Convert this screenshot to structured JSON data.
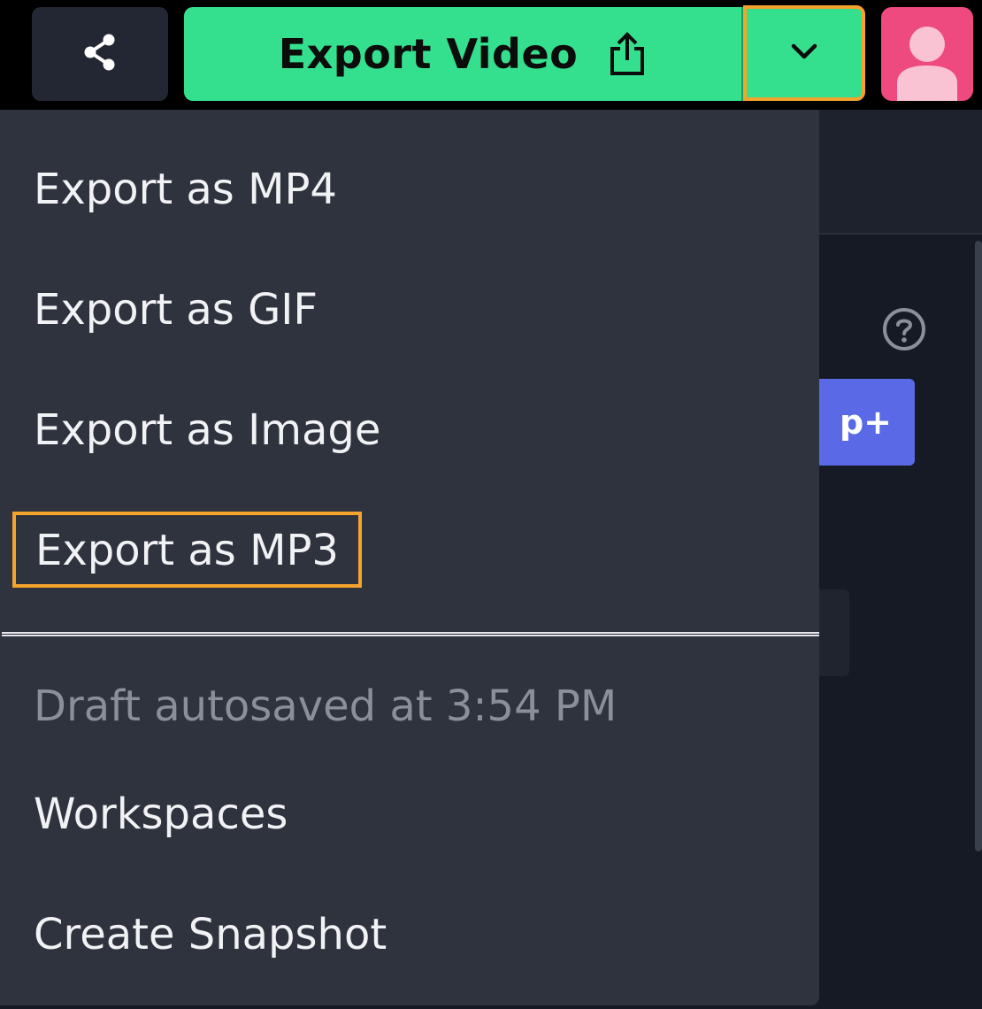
{
  "toolbar": {
    "export_label": "Export Video"
  },
  "background": {
    "upgrade_label": "p+"
  },
  "menu": {
    "items": [
      {
        "label": "Export as MP4"
      },
      {
        "label": "Export as GIF"
      },
      {
        "label": "Export as Image"
      },
      {
        "label": "Export as MP3"
      }
    ],
    "status_text": "Draft autosaved at 3:54 PM",
    "secondary_items": [
      {
        "label": "Workspaces"
      },
      {
        "label": "Create Snapshot"
      }
    ]
  },
  "colors": {
    "accent_green": "#34e08e",
    "highlight_orange": "#f4a32c",
    "menu_bg": "#2f333e",
    "avatar_pink": "#ee4a80",
    "upgrade_blue": "#5a6ae6"
  },
  "icons": {
    "share": "share-icon",
    "export": "upload-icon",
    "dropdown": "chevron-down-icon",
    "avatar": "user-icon",
    "help": "help-icon"
  }
}
